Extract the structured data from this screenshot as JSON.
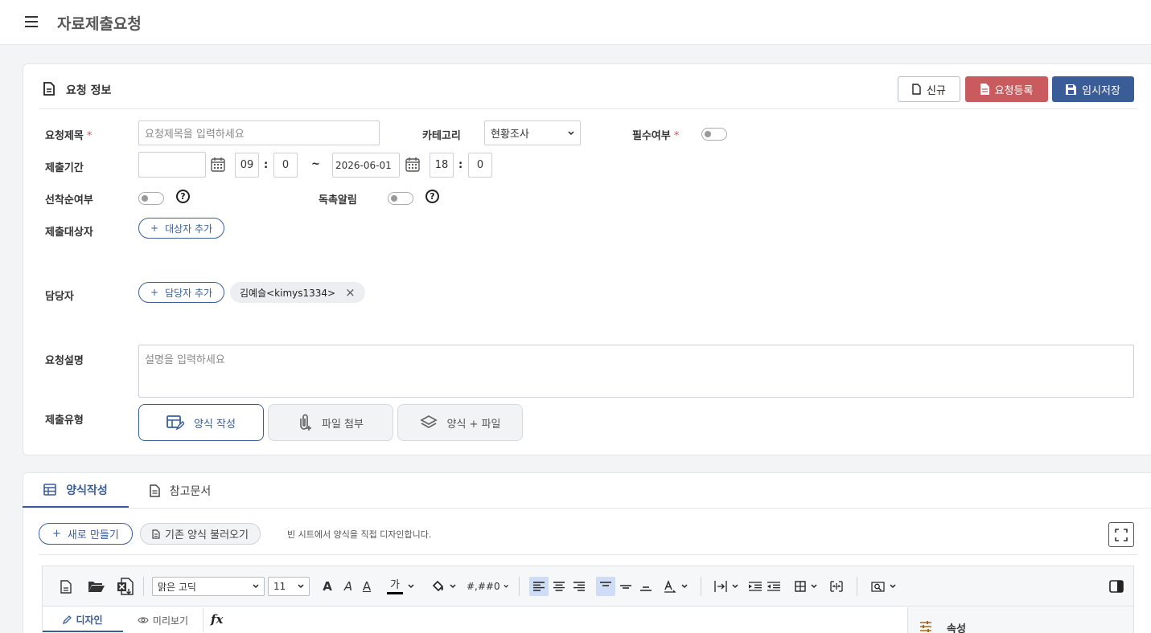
{
  "header": {
    "title": "자료제출요청"
  },
  "info_panel": {
    "title": "요청 정보",
    "buttons": {
      "new": "신규",
      "register": "요청등록",
      "save": "임시저장"
    },
    "colors": {
      "register": "#c95b5e",
      "save": "#3a5d99"
    }
  },
  "form": {
    "title_label": "요청제목",
    "title_placeholder": "요청제목을 입력하세요",
    "required_mark": "*",
    "category_label": "카테고리",
    "category_value": "현황조사",
    "mandatory_label": "필수여부",
    "period_label": "제출기간",
    "start_date": "",
    "start_hour": "09",
    "start_min": "0",
    "time_sep": ":",
    "range_sep": "~",
    "end_date": "2026-06-01",
    "end_hour": "18",
    "end_min": "0",
    "first_come_label": "선착순여부",
    "reminder_label": "독촉알림",
    "help_mark": "?",
    "targets_label": "제출대상자",
    "add_target": "대상자 추가",
    "manager_label": "담당자",
    "add_manager": "담당자 추가",
    "manager_chip": "김예슬<kimys1334>",
    "chip_remove": "×",
    "desc_label": "요청설명",
    "desc_placeholder": "설명을 입력하세요",
    "type_label": "제출유형",
    "types": [
      "양식 작성",
      "파일 첨부",
      "양식 + 파일"
    ],
    "plus": "+"
  },
  "tabs": {
    "items": [
      "양식작성",
      "참고문서"
    ],
    "active": 0
  },
  "sheet": {
    "new_btn": "새로 만들기",
    "load_btn": "기존 양식 불러오기",
    "hint": "빈 시트에서 양식을 직접 디자인합니다."
  },
  "toolbar": {
    "font": "맑은 고딕",
    "size": "11",
    "format": "#,##0",
    "color_glyph": "가",
    "bold_a": "A",
    "italic_a": "A",
    "under_a": "A"
  },
  "editor": {
    "design_tab": "디자인",
    "preview_tab": "미리보기",
    "fx": "fx",
    "props_label": "속성"
  }
}
